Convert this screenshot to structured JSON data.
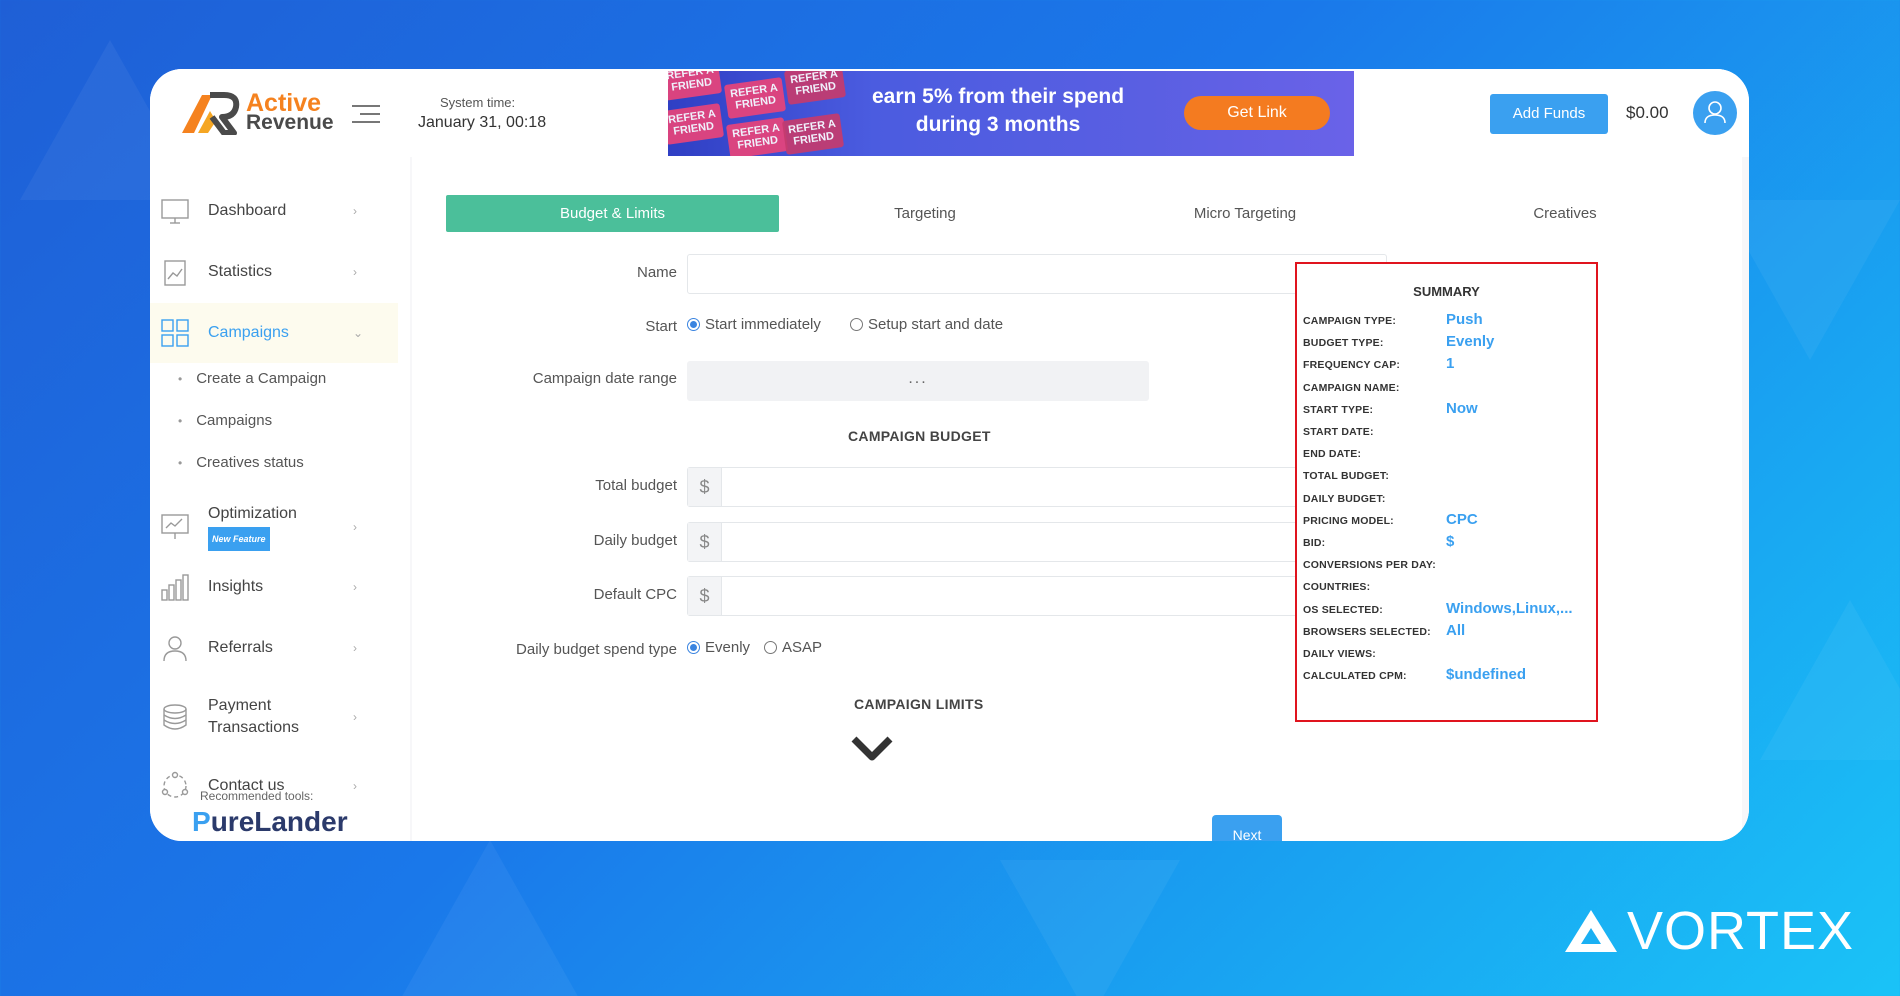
{
  "header": {
    "logo_line1": "Active",
    "logo_line2": "Revenue",
    "system_time_label": "System time:",
    "system_time_value": "January 31, 00:18",
    "banner": {
      "ticket_text": "REFER A FRIEND",
      "line1": "earn 5% from their spend",
      "line2": "during 3 months",
      "button": "Get Link"
    },
    "add_funds": "Add Funds",
    "balance": "$0.00"
  },
  "sidebar": {
    "items": [
      {
        "label": "Dashboard"
      },
      {
        "label": "Statistics"
      },
      {
        "label": "Campaigns"
      },
      {
        "label": "Optimization",
        "badge": "New Feature"
      },
      {
        "label": "Insights"
      },
      {
        "label": "Referrals"
      },
      {
        "label": "Payment\nTransactions"
      },
      {
        "label": "Contact us"
      }
    ],
    "sub_items": [
      "Create a Campaign",
      "Campaigns",
      "Creatives status"
    ],
    "recommended_label": "Recommended tools:",
    "recommended_tool": "PureLander"
  },
  "tabs": [
    "Budget & Limits",
    "Targeting",
    "Micro Targeting",
    "Creatives"
  ],
  "form": {
    "name_label": "Name",
    "start_label": "Start",
    "start_options": [
      "Start immediately",
      "Setup start and date"
    ],
    "date_range_label": "Campaign date range",
    "date_range_value": "...",
    "budget_title": "CAMPAIGN BUDGET",
    "total_budget_label": "Total budget",
    "daily_budget_label": "Daily budget",
    "default_cpc_label": "Default CPC",
    "currency": "$",
    "spend_type_label": "Daily budget spend type",
    "spend_options": [
      "Evenly",
      "ASAP"
    ],
    "limits_title": "CAMPAIGN LIMITS",
    "next": "Next"
  },
  "summary": {
    "title": "SUMMARY",
    "rows": [
      {
        "k": "CAMPAIGN TYPE:",
        "v": "Push"
      },
      {
        "k": "BUDGET TYPE:",
        "v": "Evenly"
      },
      {
        "k": "FREQUENCY CAP:",
        "v": "1"
      },
      {
        "k": "CAMPAIGN NAME:",
        "v": ""
      },
      {
        "k": "START TYPE:",
        "v": "Now"
      },
      {
        "k": "START DATE:",
        "v": ""
      },
      {
        "k": "END DATE:",
        "v": ""
      },
      {
        "k": "TOTAL BUDGET:",
        "v": ""
      },
      {
        "k": "DAILY BUDGET:",
        "v": ""
      },
      {
        "k": "PRICING MODEL:",
        "v": "CPC"
      },
      {
        "k": "BID:",
        "v": "$"
      },
      {
        "k": "CONVERSIONS PER DAY:",
        "v": ""
      },
      {
        "k": "COUNTRIES:",
        "v": ""
      },
      {
        "k": "OS SELECTED:",
        "v": "Windows,Linux,..."
      },
      {
        "k": "BROWSERS SELECTED:",
        "v": "All"
      },
      {
        "k": "DAILY VIEWS:",
        "v": ""
      },
      {
        "k": "CALCULATED CPM:",
        "v": "$undefined"
      }
    ]
  },
  "brand": "VORTEX",
  "colors": {
    "accent": "#3aa0f0",
    "active_tab": "#4bbf9a",
    "logo_orange": "#f5821f",
    "highlight_border": "#e0141e"
  }
}
